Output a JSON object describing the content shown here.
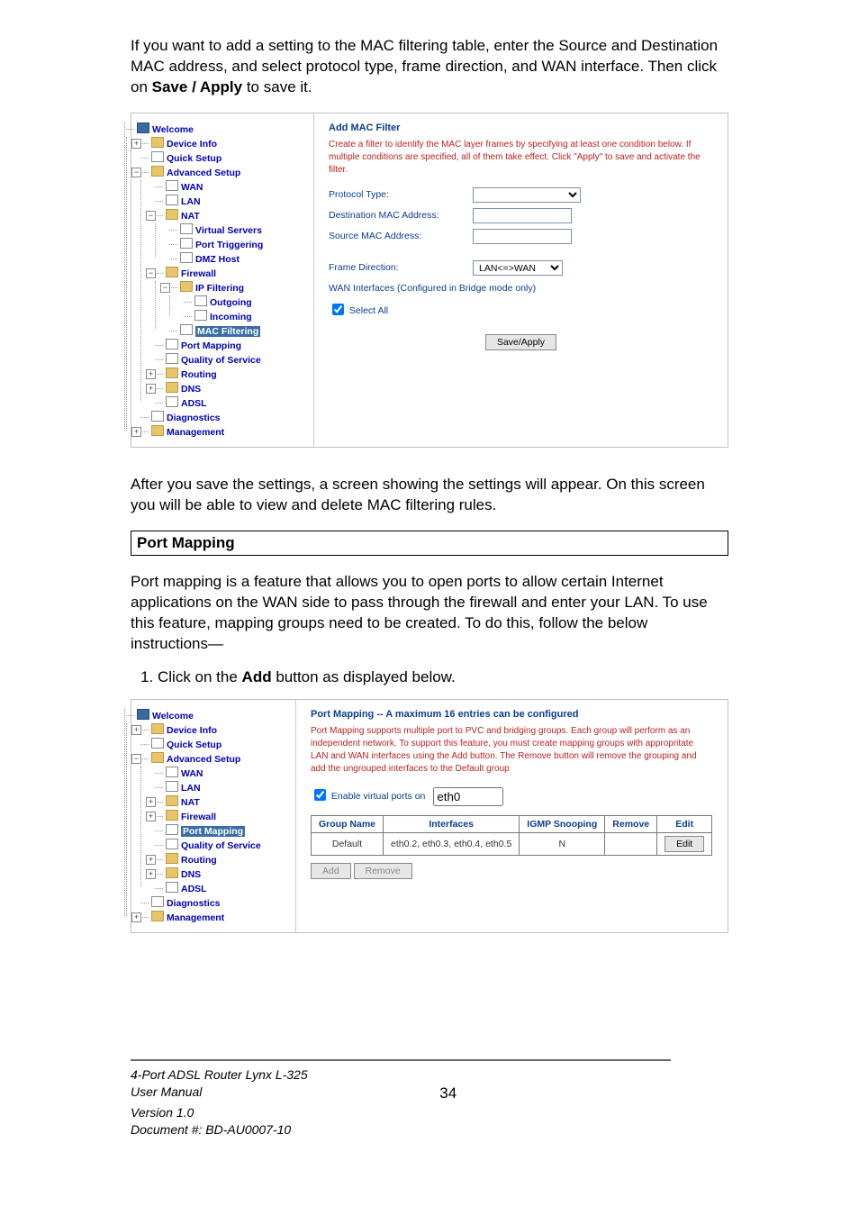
{
  "intro": {
    "p1_a": "If you want to add a setting to the MAC filtering table, enter the Source and Destination MAC address, and select protocol type, frame direction, and WAN interface. Then click on ",
    "p1_b": "Save / Apply",
    "p1_c": " to save it."
  },
  "screenshot1": {
    "title": "Add MAC Filter",
    "desc": "Create a filter to identify the MAC layer frames by specifying at least one condition below. If multiple conditions are specified, all of them take effect. Click \"Apply\" to save and activate the filter.",
    "labels": {
      "protocol": "Protocol Type:",
      "dest": "Destination MAC Address:",
      "src": "Source MAC Address:",
      "frame": "Frame Direction:",
      "frame_val": "LAN<=>WAN",
      "wan_note": "WAN Interfaces (Configured in Bridge mode only)",
      "selectall": "Select All",
      "btn": "Save/Apply"
    },
    "tree": {
      "welcome": "Welcome",
      "device_info": "Device Info",
      "quick_setup": "Quick Setup",
      "advanced_setup": "Advanced Setup",
      "wan": "WAN",
      "lan": "LAN",
      "nat": "NAT",
      "virtual_servers": "Virtual Servers",
      "port_triggering": "Port Triggering",
      "dmz_host": "DMZ Host",
      "firewall": "Firewall",
      "ip_filtering": "IP Filtering",
      "outgoing": "Outgoing",
      "incoming": "Incoming",
      "mac_filtering": "MAC Filtering",
      "port_mapping": "Port Mapping",
      "quality_of_service": "Quality of Service",
      "routing": "Routing",
      "dns": "DNS",
      "adsl": "ADSL",
      "diagnostics": "Diagnostics",
      "management": "Management"
    }
  },
  "after1": {
    "p1": "After you save the settings, a screen showing the settings will appear.  On this screen you will be able to view and delete MAC filtering rules."
  },
  "heading": "Port Mapping",
  "pm_intro": "Port mapping is a feature that allows you to open ports to allow certain Internet applications on the WAN side to pass through the firewall and enter your LAN.  To use this feature, mapping groups need to be created.  To do this, follow the below instructions—",
  "step1_a": "Click on the ",
  "step1_b": "Add",
  "step1_c": " button as displayed below.",
  "screenshot2": {
    "title": "Port Mapping -- A maximum 16 entries can be configured",
    "desc": "Port Mapping supports multiple port to PVC and bridging groups. Each group will perform as an independent network. To support this feature, you must create mapping groups with appropritate LAN and WAN interfaces using the Add button. The Remove button will remove the grouping and add the ungrouped interfaces to the Default group",
    "cb": "Enable virtual ports on",
    "cb_val": "eth0",
    "headers": {
      "group": "Group Name",
      "ifaces": "Interfaces",
      "snoop": "IGMP Snooping",
      "remove": "Remove",
      "edit": "Edit"
    },
    "row": {
      "group": "Default",
      "ifaces": "eth0.2, eth0.3, eth0.4, eth0.5",
      "snoop": "N",
      "remove": "",
      "edit": "Edit"
    },
    "btn_add": "Add",
    "btn_remove": "Remove",
    "tree": {
      "welcome": "Welcome",
      "device_info": "Device Info",
      "quick_setup": "Quick Setup",
      "advanced_setup": "Advanced Setup",
      "wan": "WAN",
      "lan": "LAN",
      "nat": "NAT",
      "firewall": "Firewall",
      "port_mapping": "Port Mapping",
      "quality_of_service": "Quality of Service",
      "routing": "Routing",
      "dns": "DNS",
      "adsl": "ADSL",
      "diagnostics": "Diagnostics",
      "management": "Management"
    }
  },
  "footer": {
    "l1": "4-Port ADSL Router Lynx L-325",
    "l2": "User Manual",
    "l3": "Version 1.0",
    "l4": "Document #:  BD-AU0007-10",
    "page": "34"
  }
}
